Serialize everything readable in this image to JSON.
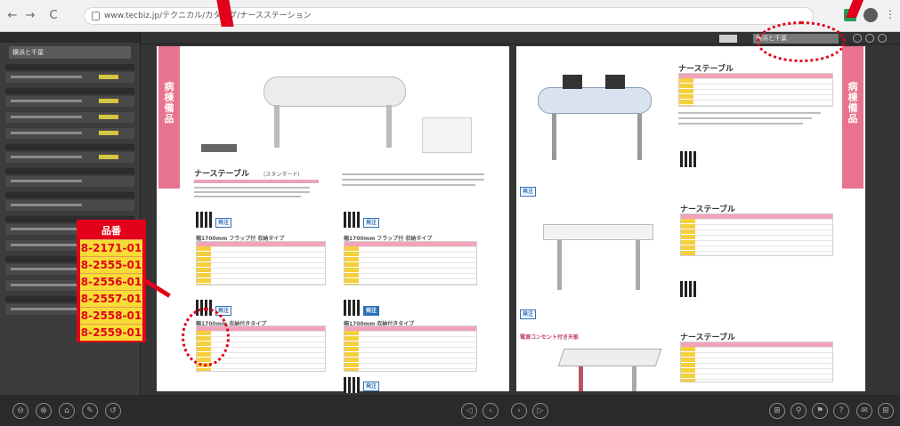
{
  "browser": {
    "nav_back": "←",
    "nav_forward": "→",
    "nav_reload": "C",
    "url": "www.tecbiz.jp/テクニカル/カタログ/ナースステーション",
    "menu_icon": "⋮",
    "extension_icon": "Z"
  },
  "sidebar": {
    "search_value": "横浜と千葉"
  },
  "viewer": {
    "search_value": "横浜と千葉"
  },
  "page_left": {
    "tab_label": "病棟備品",
    "product_title": "ナーステーブル",
    "product_sub": "(スタンダード)",
    "sub_table_a": "幅1700mm フラップ付 収納タイプ",
    "sub_table_b": "幅1700mm フラップ付 収納タイプ",
    "sub_table_c": "幅1700mm 収納付きタイプ",
    "sub_table_d": "幅1700mm 収納付きタイプ",
    "ok_label": "発注"
  },
  "page_right": {
    "tab_label": "病棟備品",
    "product_title_1": "ナーステーブル",
    "product_title_2": "ナーステーブル",
    "product_title_3": "ナーステーブル",
    "small_header": "電源コンセント付き天板",
    "ok_label": "発注"
  },
  "callout": {
    "title": "品番",
    "items": [
      "8-2171-01",
      "8-2555-01",
      "8-2556-01",
      "8-2557-01",
      "8-2558-01",
      "8-2559-01"
    ]
  },
  "bottom_toolbar": {
    "icons": [
      "⊖",
      "⊕",
      "⌂",
      "✎",
      "↺",
      "◁",
      "‹",
      "›",
      "▷",
      "⊞",
      "⚲",
      "⚑",
      "?",
      "✉",
      "⊞"
    ]
  }
}
